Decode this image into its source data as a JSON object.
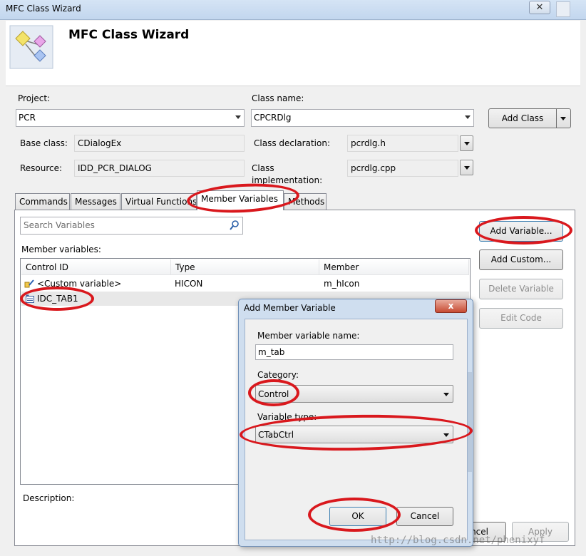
{
  "window": {
    "title": "MFC Class Wizard",
    "close_glyph": "✕"
  },
  "header": {
    "title": "MFC Class Wizard",
    "icon": "class-wizard-icon"
  },
  "form": {
    "project_label": "Project:",
    "project_value": "PCR",
    "class_name_label": "Class name:",
    "class_name_value": "CPCRDlg",
    "add_class_label": "Add Class",
    "base_class_label": "Base class:",
    "base_class_value": "CDialogEx",
    "class_declaration_label": "Class declaration:",
    "class_declaration_value": "pcrdlg.h",
    "resource_label": "Resource:",
    "resource_value": "IDD_PCR_DIALOG",
    "class_impl_label_1": "Class",
    "class_impl_label_2": "implementation:",
    "class_impl_value": "pcrdlg.cpp"
  },
  "tabs": [
    "Commands",
    "Messages",
    "Virtual Functions",
    "Member Variables",
    "Methods"
  ],
  "active_tab": "Member Variables",
  "member_panel": {
    "search_placeholder": "Search Variables",
    "list_label": "Member variables:",
    "columns": [
      "Control ID",
      "Type",
      "Member"
    ],
    "rows": [
      {
        "control_id": "<Custom variable>",
        "type": "HICON",
        "member": "m_hIcon"
      },
      {
        "control_id": "IDC_TAB1",
        "type": "",
        "member": ""
      }
    ],
    "description_label": "Description:"
  },
  "side_buttons": {
    "add_variable": "Add Variable...",
    "add_custom": "Add Custom...",
    "delete_variable": "Delete Variable",
    "edit_code": "Edit Code"
  },
  "footer_buttons": {
    "cancel_partial": "ncel",
    "apply": "Apply"
  },
  "dialog": {
    "title": "Add Member Variable",
    "close_glyph": "x",
    "name_label": "Member variable name:",
    "name_value": "m_tab",
    "category_label": "Category:",
    "category_value": "Control",
    "variable_type_label": "Variable type:",
    "variable_type_value": "CTabCtrl",
    "ok_label": "OK",
    "cancel_label": "Cancel"
  },
  "watermark": "http://blog.csdn.net/phenixyf",
  "colors": {
    "annotation": "#d9181d",
    "dialog_frame": "#cfdeef",
    "titlebar": "#c2d6ee"
  }
}
